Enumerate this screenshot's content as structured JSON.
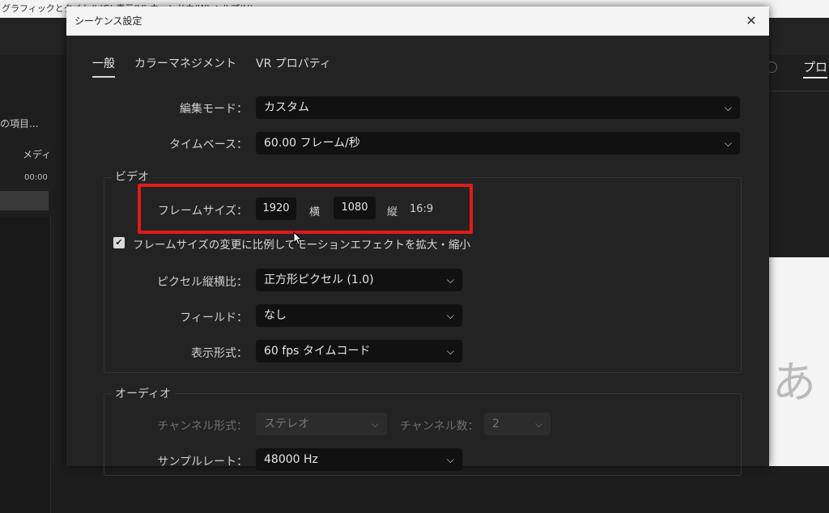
{
  "background": {
    "window_title": "グラフィックとタイトル(G)  表示(V)  ウィンドウ(W)  ヘルプ(H)",
    "left_panel": {
      "item1": "の項目...",
      "col_header": "メディ",
      "timecode": "00:00"
    },
    "right_panel": {
      "tab": "プロ",
      "preview_glyph": "あ"
    }
  },
  "dialog": {
    "title": "シーケンス設定",
    "close_glyph": "✕",
    "tabs": [
      "一般",
      "カラーマネジメント",
      "VR プロパティ"
    ],
    "edit_mode": {
      "label": "編集モード：",
      "value": "カスタム"
    },
    "timebase": {
      "label": "タイムベース：",
      "value": "60.00  フレーム/秒"
    },
    "video": {
      "group_title": "ビデオ",
      "frame_size_label": "フレームサイズ：",
      "width": "1920",
      "width_unit": "横",
      "height": "1080",
      "height_unit": "縦",
      "aspect": "16:9",
      "scale_checkbox_label": "フレームサイズの変更に比例してモーションエフェクトを拡大・縮小",
      "scale_checked": true,
      "pixel_aspect": {
        "label": "ピクセル縦横比：",
        "value": "正方形ピクセル (1.0)"
      },
      "fields": {
        "label": "フィールド：",
        "value": "なし"
      },
      "display_format": {
        "label": "表示形式：",
        "value": "60 fps タイムコード"
      }
    },
    "audio": {
      "group_title": "オーディオ",
      "channel_format": {
        "label": "チャンネル形式：",
        "value": "ステレオ"
      },
      "channel_count": {
        "label": "チャンネル数：",
        "value": "2"
      },
      "sample_rate": {
        "label": "サンプルレート：",
        "value": "48000 Hz"
      }
    }
  },
  "colors": {
    "highlight": "#e21a1a",
    "dialog_bg": "#232323",
    "field_bg": "#111111"
  }
}
